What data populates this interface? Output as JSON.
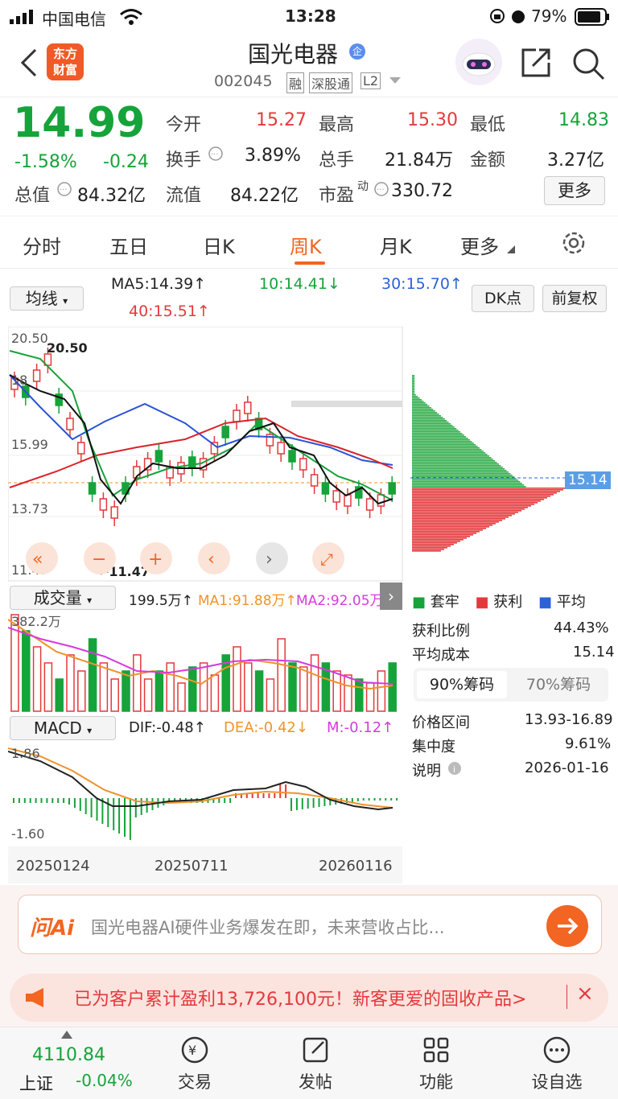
{
  "status": {
    "carrier": "中国电信",
    "time": "13:28",
    "battery": "79%"
  },
  "nav": {
    "logo_line1": "东方",
    "logo_line2": "财富",
    "title": "国光电器",
    "title_badge": "企",
    "code": "002045",
    "tags": [
      "融",
      "深股通",
      "L2"
    ]
  },
  "quote": {
    "price": "14.99",
    "change_pct": "-1.58%",
    "change": "-0.24",
    "open_label": "今开",
    "open": "15.27",
    "high_label": "最高",
    "high": "15.30",
    "low_label": "最低",
    "low": "14.83",
    "turnover_label": "换手",
    "turnover": "3.89%",
    "vol_label": "总手",
    "vol": "21.84万",
    "amount_label": "金额",
    "amount": "3.27亿",
    "mktcap_label": "总值",
    "mktcap": "84.32亿",
    "float_label": "流值",
    "float": "84.22亿",
    "pe_label": "市盈",
    "pe_sup": "动",
    "pe": "330.72",
    "more": "更多"
  },
  "tabs": [
    "分时",
    "五日",
    "日K",
    "周K",
    "月K",
    "更多"
  ],
  "active_tab": "周K",
  "ma_bar": {
    "select": "均线",
    "ma5": "MA5:14.39↑",
    "ma10": "10:14.41↓",
    "ma30": "30:15.70↑",
    "ma40": "40:15.51↑",
    "dk": "DK点",
    "fq": "前复权"
  },
  "kline": {
    "y_labels": [
      "20.50",
      "18",
      "15.99",
      "13.73",
      "11.47"
    ],
    "high_mark": "20.50",
    "low_mark": "←11.47"
  },
  "volume": {
    "select": "成交量",
    "v": "199.5万↑",
    "ma1": "MA1:91.88万↑",
    "ma2": "MA2:92.05万↑",
    "max": "382.2万"
  },
  "macd": {
    "select": "MACD",
    "dif": "DIF:-0.48↑",
    "dea": "DEA:-0.42↓",
    "m": "M:-0.12↑",
    "top": "1.86",
    "bottom": "-1.60",
    "dates": [
      "20250124",
      "20250711",
      "20260116"
    ]
  },
  "chips": {
    "price_tag": "15.14",
    "legend": [
      "套牢",
      "获利",
      "平均"
    ],
    "profit_ratio_label": "获利比例",
    "profit_ratio": "44.43%",
    "avg_cost_label": "平均成本",
    "avg_cost": "15.14",
    "tab90": "90%筹码",
    "tab70": "70%筹码",
    "range_label": "价格区间",
    "range": "13.93-16.89",
    "conc_label": "集中度",
    "conc": "9.61%",
    "note_label": "说明",
    "note_date": "2026-01-16"
  },
  "ai": {
    "logo": "问Ai",
    "text": "国光电器AI硬件业务爆发在即，未来营收占比..."
  },
  "promo": {
    "text": "已为客户累计盈利13,726,100元！新客更爱的固收产品>"
  },
  "bottom": {
    "index_value": "4110.84",
    "index_name": "上证",
    "index_change": "-0.04%",
    "items": [
      "交易",
      "发帖",
      "功能",
      "设自选"
    ]
  },
  "colors": {
    "up": "#e4393c",
    "down": "#16a33a",
    "accent": "#f26522"
  }
}
